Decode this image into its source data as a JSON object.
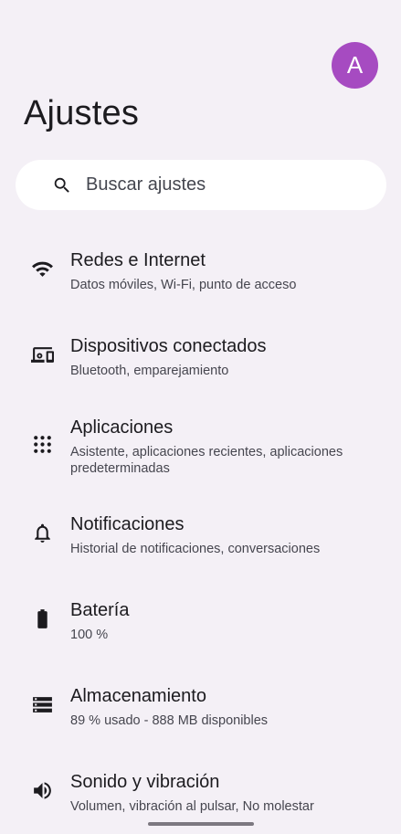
{
  "header": {
    "avatar_letter": "A",
    "title": "Ajustes"
  },
  "search": {
    "label": "Buscar ajustes",
    "icon": "search-icon"
  },
  "settings": [
    {
      "title": "Redes e Internet",
      "subtitle": "Datos móviles, Wi-Fi, punto de acceso",
      "icon": "wifi-icon"
    },
    {
      "title": "Dispositivos conectados",
      "subtitle": "Bluetooth, emparejamiento",
      "icon": "devices-icon"
    },
    {
      "title": "Aplicaciones",
      "subtitle": "Asistente, aplicaciones recientes, aplicaciones predeterminadas",
      "icon": "apps-grid-icon"
    },
    {
      "title": "Notificaciones",
      "subtitle": "Historial de notificaciones, conversaciones",
      "icon": "bell-icon"
    },
    {
      "title": "Batería",
      "subtitle": "100 %",
      "icon": "battery-icon"
    },
    {
      "title": "Almacenamiento",
      "subtitle": "89 % usado - 888 MB disponibles",
      "icon": "storage-icon"
    },
    {
      "title": "Sonido y vibración",
      "subtitle": "Volumen, vibración al pulsar, No molestar",
      "icon": "volume-icon"
    }
  ],
  "colors": {
    "background": "#F4F0F6",
    "avatar": "#A64BC1",
    "search_bg": "#FFFFFF",
    "text_primary": "#1C1B1F",
    "text_secondary": "#46464F"
  }
}
